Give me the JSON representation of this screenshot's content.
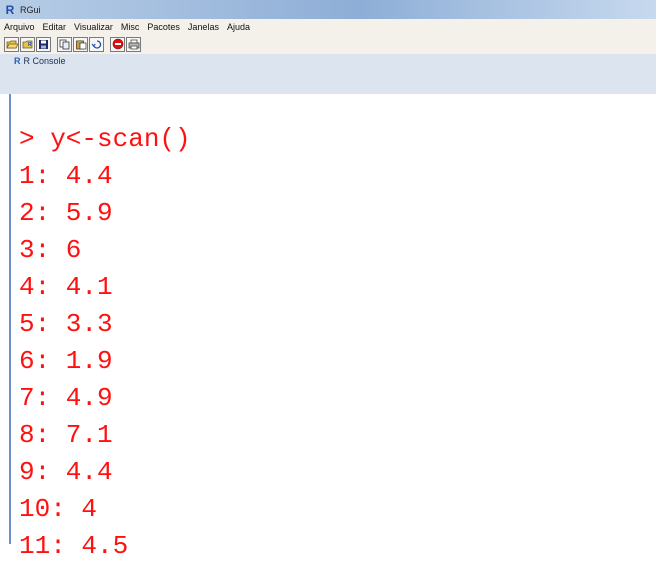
{
  "window": {
    "title": "RGui",
    "app_icon_letter": "R"
  },
  "menu": [
    "Arquivo",
    "Editar",
    "Visualizar",
    "Misc",
    "Pacotes",
    "Janelas",
    "Ajuda"
  ],
  "toolbar_icons": [
    "open-script-icon",
    "load-workspace-icon",
    "save-icon",
    "copy-icon",
    "paste-icon",
    "copy-paste-icon",
    "stop-icon",
    "print-icon"
  ],
  "console": {
    "title": "R Console",
    "lines": [
      "> y<-scan()",
      "1: 4.4",
      "2: 5.9",
      "3: 6",
      "4: 4.1",
      "5: 3.3",
      "6: 1.9",
      "7: 4.9",
      "8: 7.1",
      "9: 4.4",
      "10: 4",
      "11: 4.5"
    ]
  },
  "colors": {
    "console_text": "#ff1111",
    "accent": "#2b5fb8"
  }
}
